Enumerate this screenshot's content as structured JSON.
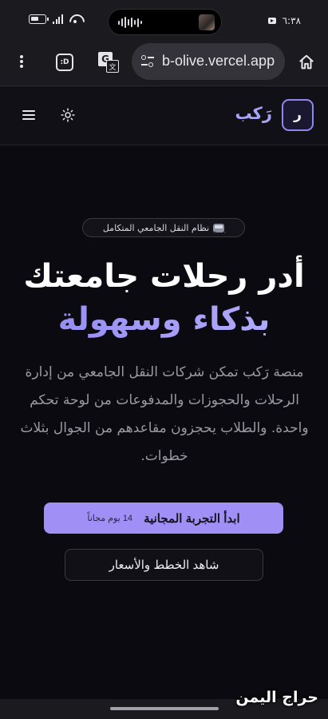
{
  "status_bar": {
    "time": "٦:٣٨",
    "icons": [
      "battery-saver-icon",
      "signal-icon",
      "wifi-icon",
      "video-call-icon",
      "waveform-icon"
    ]
  },
  "browser": {
    "url": "b-olive.vercel.app",
    "tab_indicator": ":D",
    "translate_glyph": "G",
    "translate_sub": "文"
  },
  "site_header": {
    "logo_letter": "ر",
    "logo_text": "رَكب"
  },
  "hero": {
    "badge_text": "نظام النقل الجامعي المتكامل",
    "headline_line1": "أدر رحلات جامعتك",
    "headline_line2": "بذكاء وسهولة",
    "description": "منصة رَكب تمكن شركات النقل الجامعي من إدارة الرحلات والحجوزات والمدفوعات من لوحة تحكم واحدة. والطلاب يحجزون مقاعدهم من الجوال بثلاث خطوات.",
    "cta_primary_label": "ابدأ التجربة المجانية",
    "cta_primary_sub": "14 يوم مجاناً",
    "cta_secondary_label": "شاهد الخطط والأسعار"
  },
  "watermark": "حراج اليمن",
  "colors": {
    "accent": "#a08ff5",
    "accent_light": "#b7b1fb",
    "background": "#0b0a10",
    "muted_text": "#9a99a3"
  }
}
